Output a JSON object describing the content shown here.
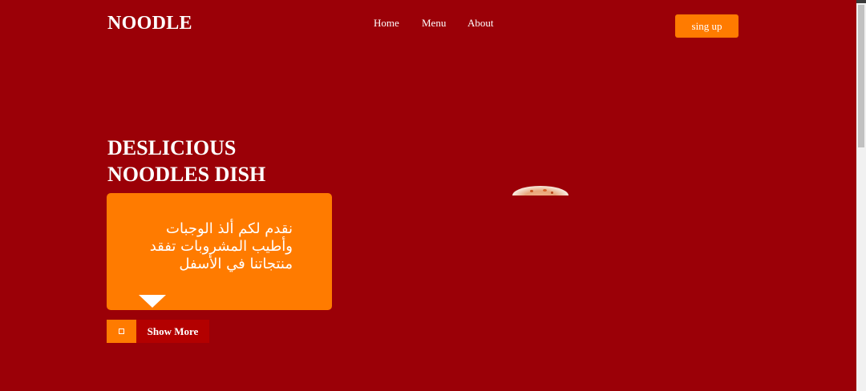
{
  "header": {
    "logo": "NOODLE",
    "nav": [
      {
        "label": "Home"
      },
      {
        "label": "Menu"
      },
      {
        "label": "About"
      }
    ],
    "signup_label": "sing up"
  },
  "hero": {
    "title_line1": "DESLICIOUS",
    "title_line2": "NOODLES DISH",
    "card_text": "نقدم لكم ألذ الوجبات وأطيب المشروبات تفقد منتجاتنا في الأسفل",
    "show_more_label": "Show More"
  },
  "colors": {
    "background": "#9b0007",
    "accent": "#ff7b00",
    "button_dark": "#b30000"
  },
  "icons": {
    "card_arrow": "triangle-down-icon",
    "show_more_icon": "square-icon"
  }
}
